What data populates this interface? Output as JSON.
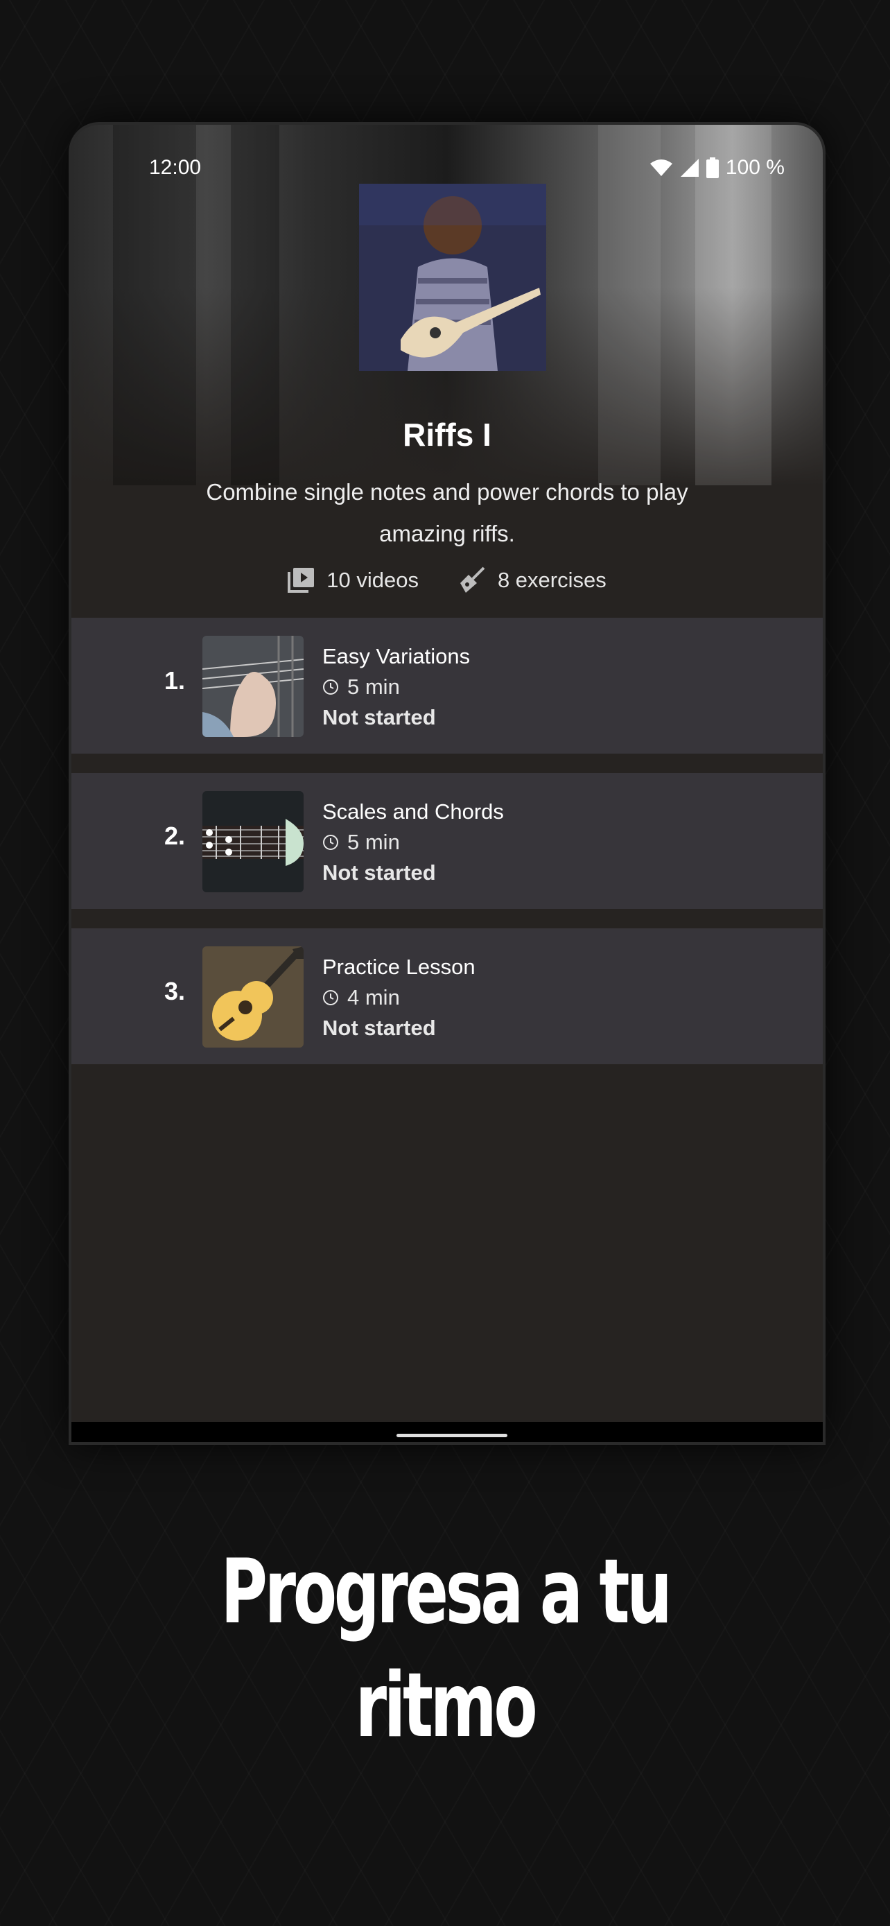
{
  "status_bar": {
    "time": "12:00",
    "battery": "100 %"
  },
  "course": {
    "title": "Riffs I",
    "description": "Combine single notes and power chords to play amazing riffs.",
    "videos": "10 videos",
    "exercises": "8 exercises"
  },
  "lessons": [
    {
      "number": "1.",
      "name": "Easy Variations",
      "duration": "5 min",
      "status": "Not started"
    },
    {
      "number": "2.",
      "name": "Scales and Chords",
      "duration": "5 min",
      "status": "Not started"
    },
    {
      "number": "3.",
      "name": "Practice Lesson",
      "duration": "4 min",
      "status": "Not started"
    }
  ],
  "promo": {
    "line1": "Progresa a tu",
    "line2": "ritmo"
  },
  "colors": {
    "background": "#121212",
    "panel": "#262321",
    "row": "#37353a"
  },
  "icons": [
    "wifi-icon",
    "signal-icon",
    "battery-icon",
    "video-library-icon",
    "guitar-icon",
    "clock-icon"
  ]
}
